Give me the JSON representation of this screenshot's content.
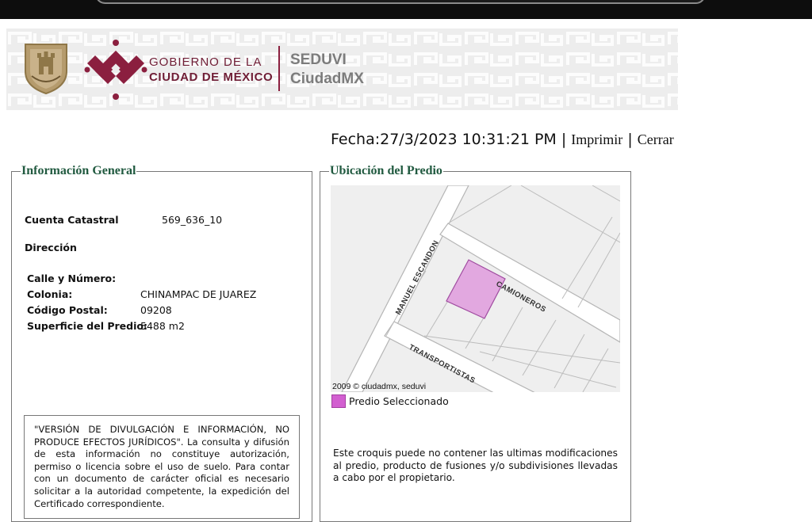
{
  "header": {
    "gobierno_line1": "GOBIERNO DE LA",
    "gobierno_line2": "CIUDAD DE MÉXICO",
    "agency_line1": "SEDUVI",
    "agency_line2": "CiudadMX"
  },
  "datebar": {
    "fecha": "Fecha:27/3/2023 10:31:21 PM",
    "sep": "|",
    "imprimir": "Imprimir",
    "cerrar": "Cerrar"
  },
  "info": {
    "legend": "Información General",
    "cuenta_label": "Cuenta Catastral",
    "cuenta_value": "569_636_10",
    "direccion_label": "Dirección",
    "calle_label": "Calle y Número:",
    "calle_value": "",
    "colonia_label": "Colonia:",
    "colonia_value": "CHINAMPAC DE JUAREZ",
    "cp_label": "Código Postal:",
    "cp_value": "09208",
    "superficie_label": "Superficie del Predio:",
    "superficie_value": "5488 m2",
    "disclaimer": "\"VERSIÓN DE DIVULGACIÓN E INFORMACIÓN, NO PRODUCE EFECTOS JURÍDICOS\". La consulta y difusión de esta información no constituye autorización, permiso o licencia sobre el uso de suelo. Para contar con un documento de carácter oficial es necesario solicitar a la autoridad competente, la expedición del Certificado correspondiente."
  },
  "ubicacion": {
    "legend": "Ubicación del Predio",
    "map": {
      "street_1": "MANUEL ESCANDON",
      "street_2": "CAMIONEROS",
      "street_3": "TRANSPORTISTAS",
      "copyright": "2009 © ciudadmx, seduvi"
    },
    "legend_item": "Predio Seleccionado",
    "note": "Este croquis puede no contener las ultimas modificaciones al predio, producto de fusiones y/o subdivisiones llevadas a cabo por el propietario."
  },
  "colors": {
    "brand": "#6f1d35",
    "legend_title": "#215a40",
    "selected_lot": "#e2a8e0",
    "legend_swatch": "#d25fd0"
  }
}
